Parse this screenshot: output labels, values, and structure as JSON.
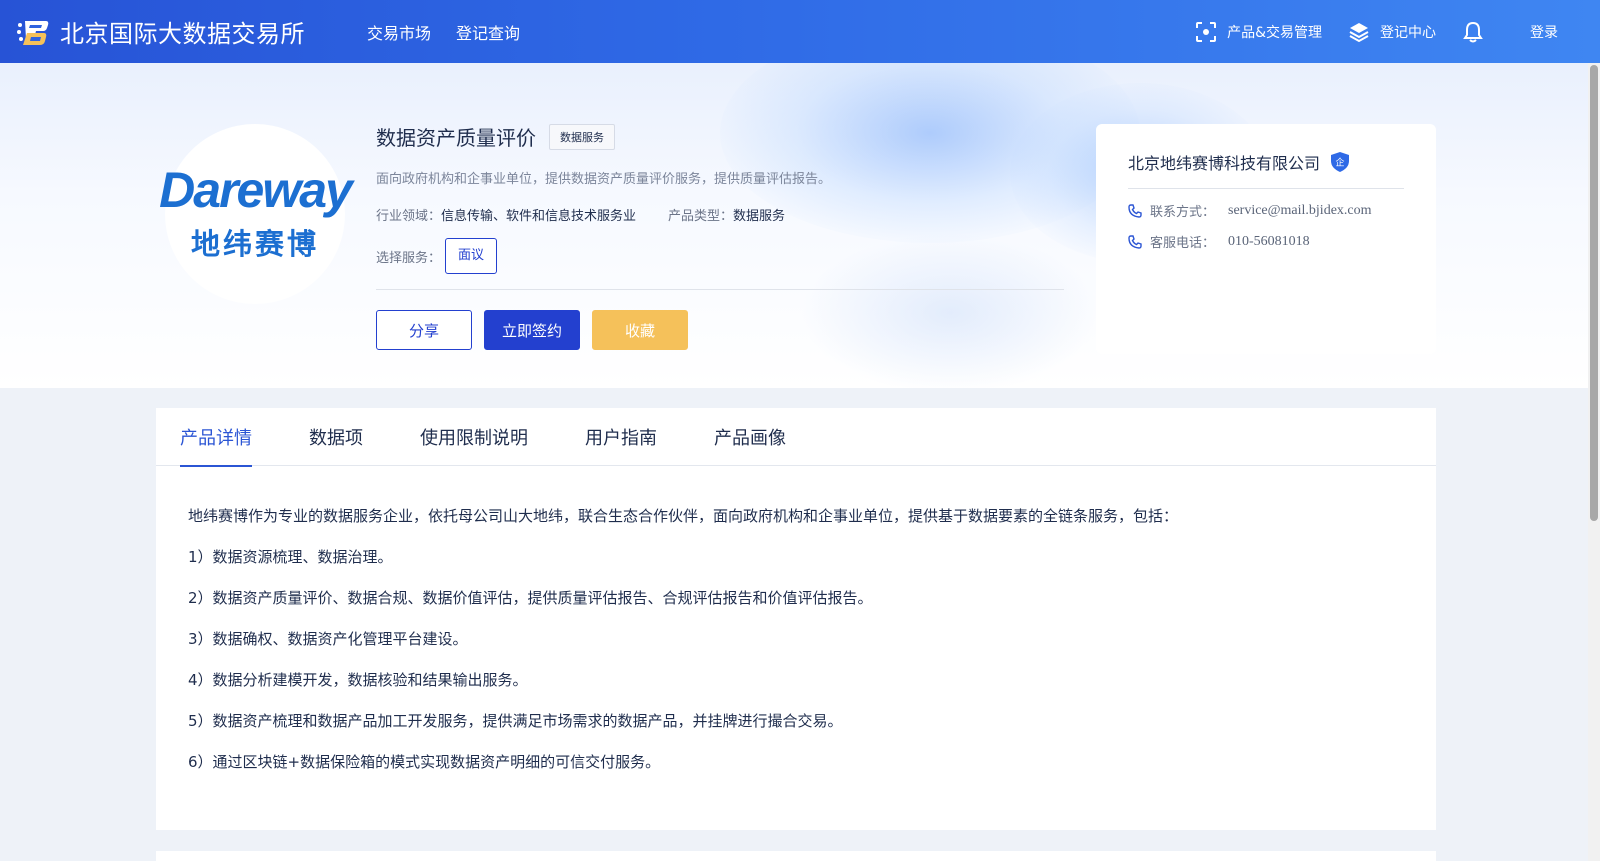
{
  "header": {
    "site_title": "北京国际大数据交易所",
    "nav": [
      "交易市场",
      "登记查询"
    ],
    "right": {
      "product_mgmt": "产品&交易管理",
      "register_center": "登记中心",
      "login": "登录"
    }
  },
  "product": {
    "logo_text_en": "Dareway",
    "logo_text_cn": "地纬赛博",
    "title": "数据资产质量评价",
    "tag": "数据服务",
    "description": "面向政府机构和企事业单位，提供数据资产质量评价服务，提供质量评估报告。",
    "industry_label": "行业领域：",
    "industry_value": "信息传输、软件和信息技术服务业",
    "type_label": "产品类型：",
    "type_value": "数据服务",
    "service_label": "选择服务：",
    "service_option": "面议",
    "actions": {
      "share": "分享",
      "sign": "立即签约",
      "favorite": "收藏"
    }
  },
  "company": {
    "name": "北京地纬赛博科技有限公司",
    "badge": "企",
    "contact_label": "联系方式：",
    "contact_value": "service@mail.bjidex.com",
    "phone_label": "客服电话：",
    "phone_value": "010-56081018"
  },
  "tabs": [
    "产品详情",
    "数据项",
    "使用限制说明",
    "用户指南",
    "产品画像"
  ],
  "active_tab": "产品详情",
  "detail_paragraphs": [
    "地纬赛博作为专业的数据服务企业，依托母公司山大地纬，联合生态合作伙伴，面向政府机构和企事业单位，提供基于数据要素的全链条服务，包括：",
    "1）数据资源梳理、数据治理。",
    "2）数据资产质量评价、数据合规、数据价值评估，提供质量评估报告、合规评估报告和价值评估报告。",
    "3）数据确权、数据资产化管理平台建设。",
    "4）数据分析建模开发，数据核验和结果输出服务。",
    "5）数据资产梳理和数据产品加工开发服务，提供满足市场需求的数据产品，并挂牌进行撮合交易。",
    "6）通过区块链+数据保险箱的模式实现数据资产明细的可信交付服务。"
  ],
  "colors": {
    "primary": "#2340cf",
    "tab_active": "#2b55d4",
    "favorite": "#f5c15a"
  }
}
